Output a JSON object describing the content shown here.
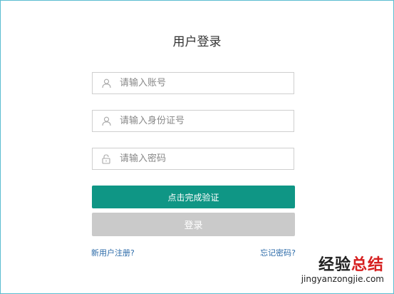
{
  "login": {
    "title": "用户登录",
    "account_placeholder": "请输入账号",
    "id_placeholder": "请输入身份证号",
    "password_placeholder": "请输入密码",
    "verify_label": "点击完成验证",
    "login_label": "登录",
    "register_link": "新用户注册?",
    "forgot_link": "忘记密码?"
  },
  "icons": {
    "account": "user-icon",
    "id": "user-icon",
    "password": "lock-icon"
  },
  "colors": {
    "accent": "#0f9685",
    "disabled": "#cacaca",
    "link": "#2b6aa8",
    "frame": "#5bbdd0"
  },
  "watermark": {
    "text_dark": "经验",
    "text_red": "总结",
    "url": "jingyanzongjie.com"
  }
}
